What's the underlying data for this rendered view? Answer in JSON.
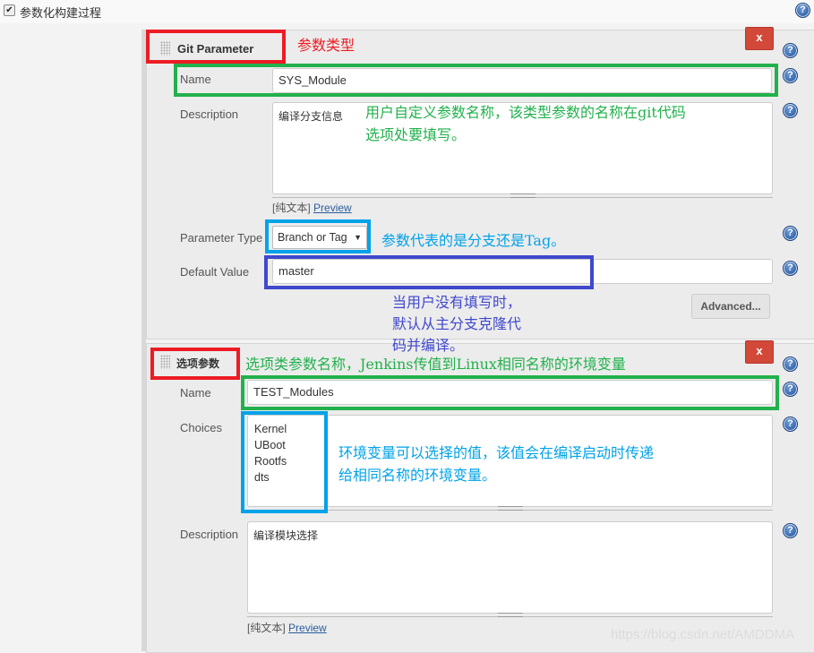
{
  "header": {
    "checkbox_checked": true,
    "checkbox_glyph": "✔",
    "label": "参数化构建过程",
    "help_glyph": "?"
  },
  "git_param": {
    "title": "Git Parameter",
    "delete_label": "x",
    "name_label": "Name",
    "name_value": "SYS_Module",
    "description_label": "Description",
    "description_value": "编译分支信息",
    "plain_text_label": "[纯文本]",
    "preview_link": "Preview",
    "parameter_type_label": "Parameter Type",
    "parameter_type_value": "Branch or Tag",
    "dropdown_glyph": "▼",
    "default_value_label": "Default Value",
    "default_value": "master",
    "advanced_button": "Advanced..."
  },
  "choice_param": {
    "title": "选项参数",
    "delete_label": "x",
    "name_label": "Name",
    "name_value": "TEST_Modules",
    "choices_label": "Choices",
    "choices": [
      "Kernel",
      "UBoot",
      "Rootfs",
      "dts"
    ],
    "description_label": "Description",
    "description_value": "编译模块选择",
    "plain_text_label": "[纯文本]",
    "preview_link": "Preview"
  },
  "annotations": {
    "param_type": "参数类型",
    "name_note_line1": "用户自定义参数名称，该类型参数的名称在git代码",
    "name_note_line2": "选项处要填写。",
    "branch_tag_note": "参数代表的是分支还是Tag。",
    "default_note_line1": "当用户没有填写时，",
    "default_note_line2": "默认从主分支克隆代",
    "default_note_line3": "码并编译。",
    "choice_name_note": "选项类参数名称，Jenkins传值到Linux相同名称的环境变量",
    "choices_note_line1": "环境变量可以选择的值，该值会在编译启动时传递",
    "choices_note_line2": "给相同名称的环境变量。",
    "colors": {
      "red": "#ed1c24",
      "green": "#22b14c",
      "cyan": "#00a2e8",
      "blue": "#3f48cc"
    }
  },
  "watermark": "https://blog.csdn.net/AMDDMA"
}
